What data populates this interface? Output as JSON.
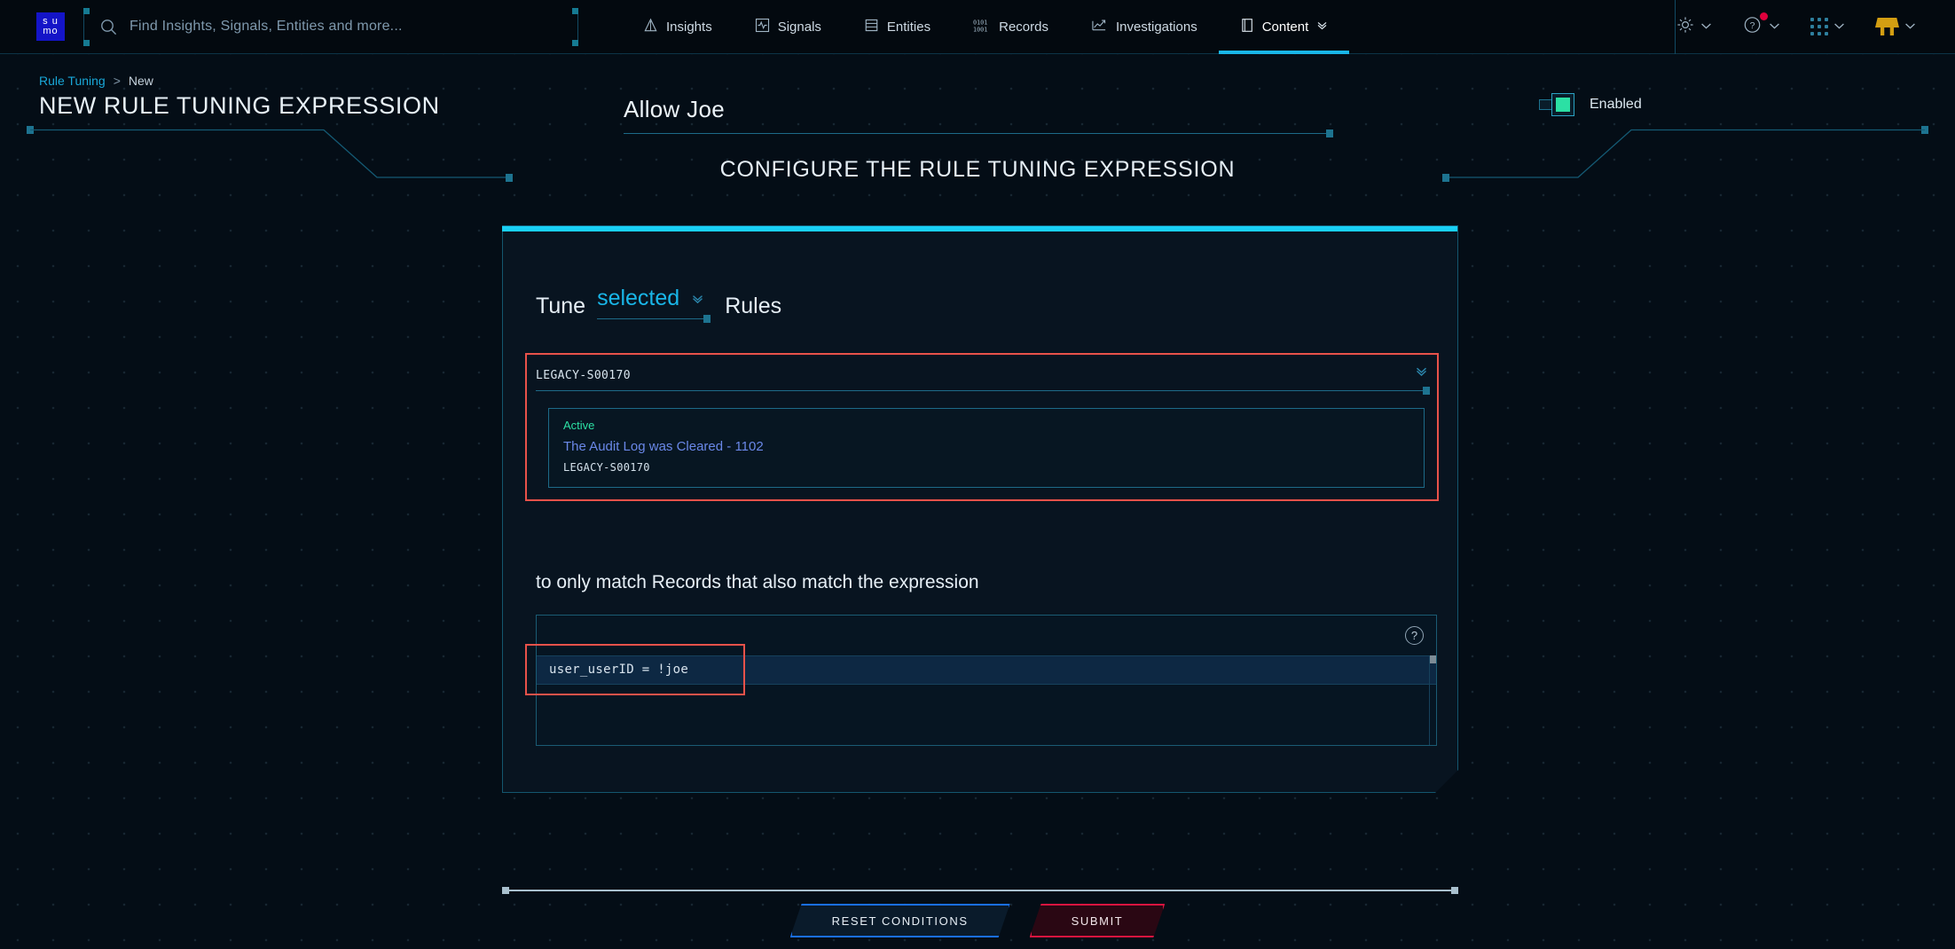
{
  "brand": {
    "logo_line1": "s u",
    "logo_line2": "mo"
  },
  "search": {
    "placeholder": "Find Insights, Signals, Entities and more...",
    "icon": "search-icon"
  },
  "nav": {
    "tabs": [
      {
        "label": "Insights",
        "icon": "insights-icon",
        "active": false
      },
      {
        "label": "Signals",
        "icon": "signals-icon",
        "active": false
      },
      {
        "label": "Entities",
        "icon": "entities-icon",
        "active": false
      },
      {
        "label": "Records",
        "icon": "records-icon",
        "active": false
      },
      {
        "label": "Investigations",
        "icon": "investigations-icon",
        "active": false
      },
      {
        "label": "Content",
        "icon": "content-icon",
        "active": true
      }
    ],
    "right_icons": [
      {
        "name": "gear-icon",
        "badge": false
      },
      {
        "name": "help-icon",
        "badge": true
      },
      {
        "name": "apps-grid-icon",
        "badge": false
      },
      {
        "name": "user-avatar-icon",
        "badge": false
      }
    ]
  },
  "breadcrumb": {
    "root": "Rule Tuning",
    "separator": ">",
    "current": "New"
  },
  "header": {
    "page_title": "NEW RULE TUNING EXPRESSION",
    "name_value": "Allow Joe",
    "toggle_label": "Enabled",
    "toggle_on": true,
    "main_heading": "CONFIGURE THE RULE TUNING EXPRESSION"
  },
  "panel": {
    "tune_prefix": "Tune",
    "tune_selected": "selected",
    "tune_suffix": "Rules",
    "rule_select_value": "LEGACY-S00170",
    "rule_card": {
      "status": "Active",
      "name": "The Audit Log was Cleared - 1102",
      "id": "LEGACY-S00170"
    },
    "expression_label": "to only match Records that also match the expression",
    "expression_code": "user_userID = !joe",
    "help_glyph": "?"
  },
  "footer": {
    "reset_label": "RESET CONDITIONS",
    "submit_label": "SUBMIT"
  },
  "colors": {
    "accent_cyan": "#19d0f5",
    "link_blue": "#19a7d8",
    "status_green": "#2ce0a4",
    "annotation_red": "#e8524a",
    "submit_red": "#d8143f",
    "reset_blue": "#1a6fe8",
    "panel_bg": "#081420",
    "page_bg": "#040d16"
  }
}
